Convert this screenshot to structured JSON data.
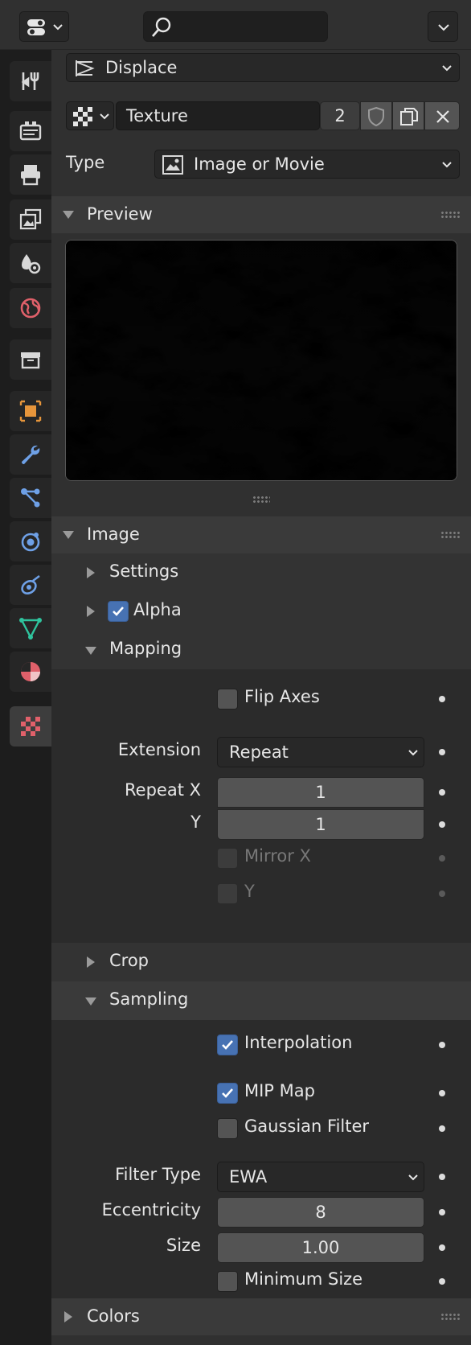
{
  "header": {
    "editor_type_icon": "properties-editor-icon",
    "search_icon": "search-icon",
    "menu_icon": "chevron-down-icon"
  },
  "tabs": [
    {
      "name": "tool",
      "icon": "tool-icon"
    },
    {
      "name": "render",
      "icon": "render-icon"
    },
    {
      "name": "output",
      "icon": "output-icon"
    },
    {
      "name": "view-layer",
      "icon": "view-layer-icon"
    },
    {
      "name": "scene",
      "icon": "scene-icon"
    },
    {
      "name": "world",
      "icon": "world-icon"
    },
    {
      "name": "collection",
      "icon": "collection-icon"
    },
    {
      "name": "object",
      "icon": "object-icon"
    },
    {
      "name": "modifiers",
      "icon": "wrench-icon"
    },
    {
      "name": "particles",
      "icon": "particles-icon"
    },
    {
      "name": "physics",
      "icon": "physics-icon"
    },
    {
      "name": "constraints",
      "icon": "constraints-icon"
    },
    {
      "name": "data",
      "icon": "mesh-data-icon"
    },
    {
      "name": "material",
      "icon": "material-icon"
    },
    {
      "name": "texture",
      "icon": "texture-icon",
      "active": true
    }
  ],
  "context": {
    "modifier_name": "Displace"
  },
  "texture": {
    "name": "Texture",
    "users": "2"
  },
  "type": {
    "label": "Type",
    "value": "Image or Movie"
  },
  "panels": {
    "preview": "Preview",
    "image": "Image",
    "colors": "Colors"
  },
  "image": {
    "settings": "Settings",
    "alpha": "Alpha",
    "mapping": "Mapping",
    "crop": "Crop",
    "sampling": "Sampling"
  },
  "mapping": {
    "flip_axes": "Flip Axes",
    "extension_label": "Extension",
    "extension_value": "Repeat",
    "repeat_x_label": "Repeat X",
    "repeat_x_value": "1",
    "y_label": "Y",
    "y_value": "1",
    "mirror_x": "Mirror X",
    "mirror_y": "Y"
  },
  "sampling": {
    "interpolation": "Interpolation",
    "mip_map": "MIP Map",
    "gaussian": "Gaussian Filter",
    "filter_type_label": "Filter Type",
    "filter_type_value": "EWA",
    "eccentricity_label": "Eccentricity",
    "eccentricity_value": "8",
    "size_label": "Size",
    "size_value": "1.00",
    "min_size": "Minimum Size"
  },
  "colors": {
    "accent": "#4772b3",
    "panel": "#3a3a3a",
    "bg": "#303030"
  }
}
